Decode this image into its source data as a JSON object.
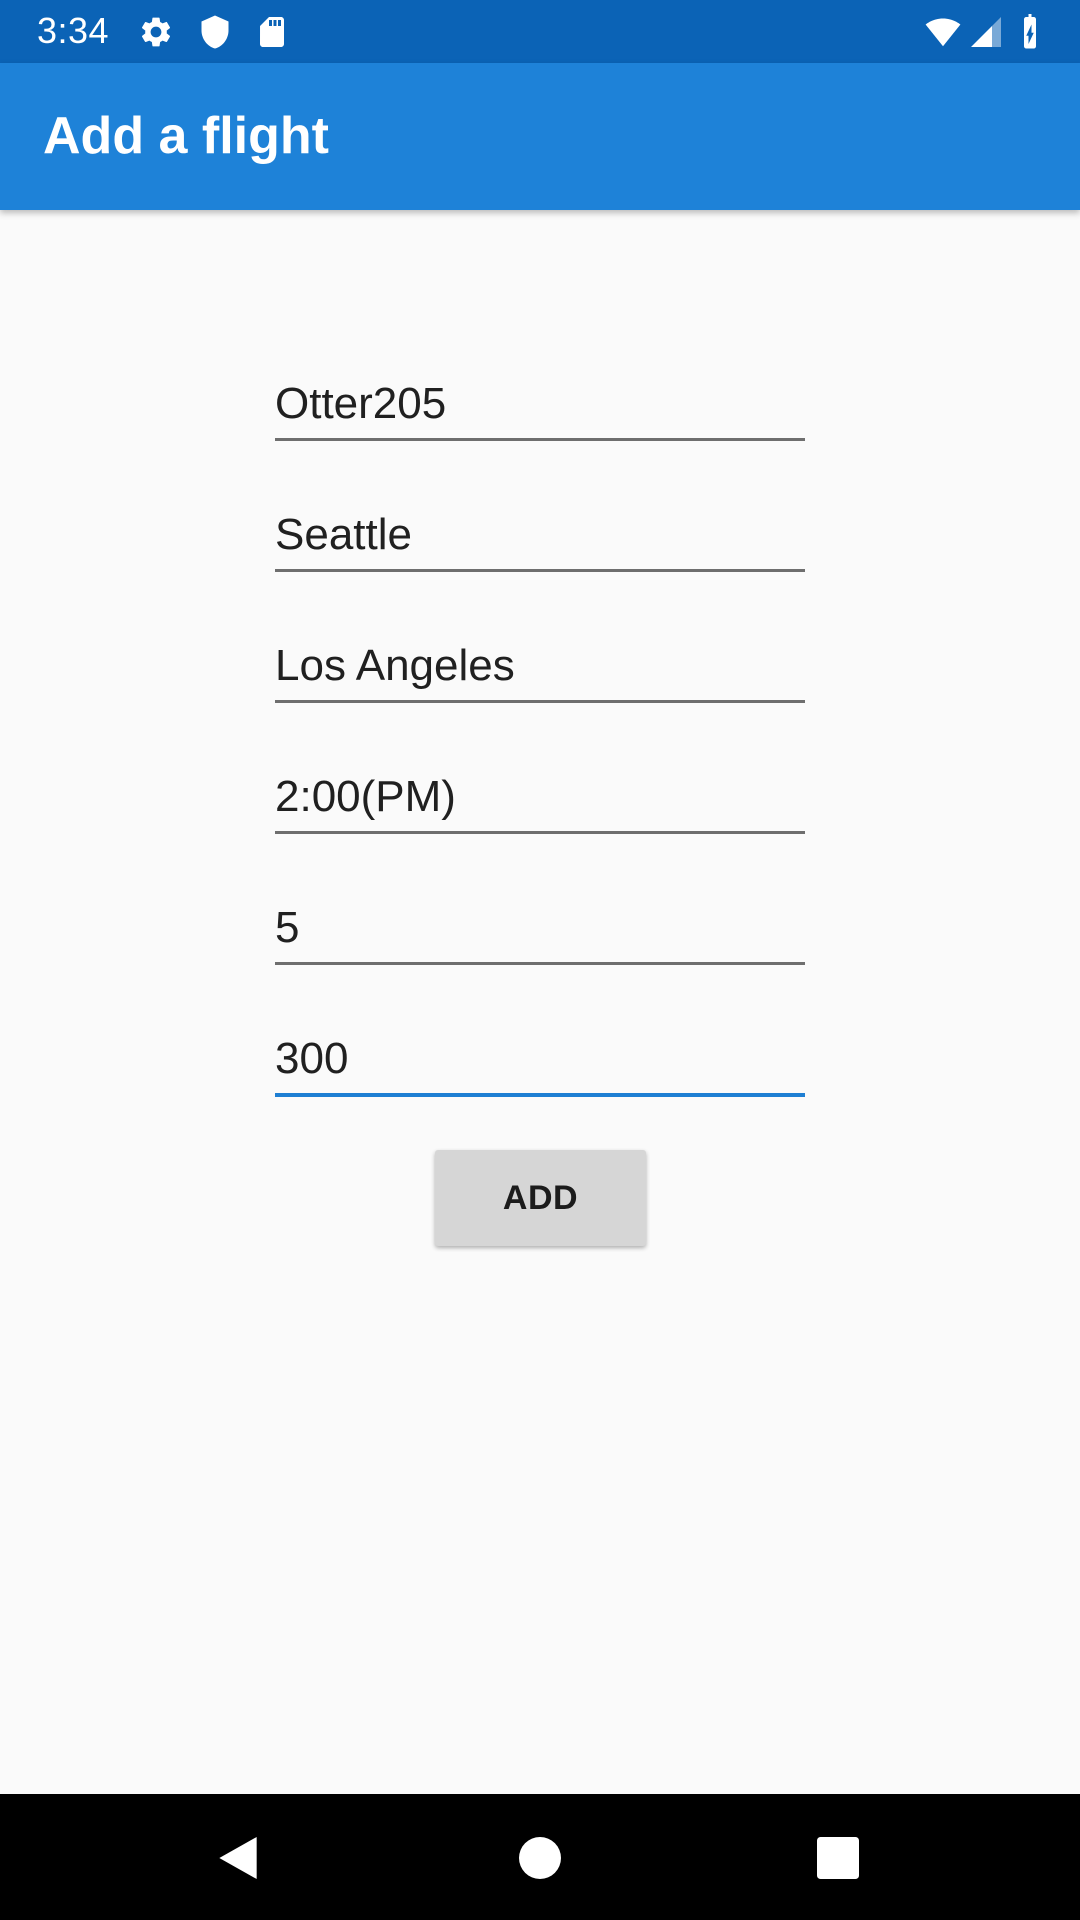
{
  "status_bar": {
    "time": "3:34",
    "left_icons": [
      "gear-icon",
      "shield-icon",
      "sd-card-icon"
    ],
    "right_icons": [
      "wifi-icon",
      "cell-signal-icon",
      "battery-charging-icon"
    ]
  },
  "app_bar": {
    "title": "Add a flight",
    "color": "#1e82d8"
  },
  "form": {
    "fields": [
      {
        "value": "Otter205"
      },
      {
        "value": "Seattle"
      },
      {
        "value": "Los Angeles"
      },
      {
        "value": "2:00(PM)"
      },
      {
        "value": "5"
      },
      {
        "value": "300"
      }
    ],
    "add_label": "ADD"
  },
  "nav_bar": {
    "icons": [
      "back-icon",
      "home-icon",
      "recents-icon"
    ]
  }
}
